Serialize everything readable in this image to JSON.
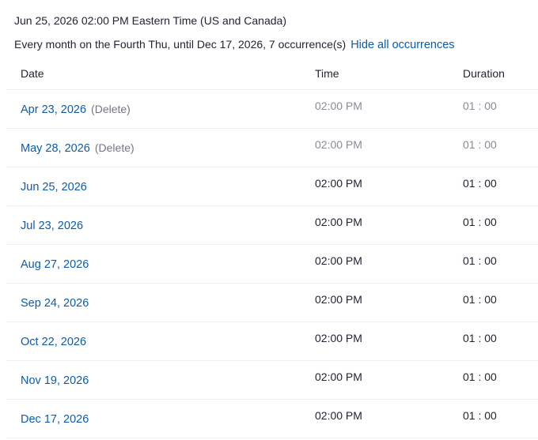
{
  "header": {
    "datetime": "Jun 25, 2026 02:00 PM Eastern Time (US and Canada)",
    "recurrence": "Every month on the Fourth Thu, until Dec 17, 2026, 7 occurrence(s)",
    "hide_link": "Hide all occurrences"
  },
  "table": {
    "columns": {
      "date": "Date",
      "time": "Time",
      "duration": "Duration"
    },
    "delete_label": "(Delete)",
    "rows": [
      {
        "date": "Apr 23, 2026",
        "time": "02:00 PM",
        "duration": "01 : 00",
        "deleted": true
      },
      {
        "date": "May 28, 2026",
        "time": "02:00 PM",
        "duration": "01 : 00",
        "deleted": true
      },
      {
        "date": "Jun 25, 2026",
        "time": "02:00 PM",
        "duration": "01 : 00",
        "deleted": false
      },
      {
        "date": "Jul 23, 2026",
        "time": "02:00 PM",
        "duration": "01 : 00",
        "deleted": false
      },
      {
        "date": "Aug 27, 2026",
        "time": "02:00 PM",
        "duration": "01 : 00",
        "deleted": false
      },
      {
        "date": "Sep 24, 2026",
        "time": "02:00 PM",
        "duration": "01 : 00",
        "deleted": false
      },
      {
        "date": "Oct 22, 2026",
        "time": "02:00 PM",
        "duration": "01 : 00",
        "deleted": false
      },
      {
        "date": "Nov 19, 2026",
        "time": "02:00 PM",
        "duration": "01 : 00",
        "deleted": false
      },
      {
        "date": "Dec 17, 2026",
        "time": "02:00 PM",
        "duration": "01 : 00",
        "deleted": false
      }
    ]
  },
  "colors": {
    "link": "#0b5cad",
    "text": "#232333",
    "muted": "#747487",
    "divider": "#ededf4"
  }
}
